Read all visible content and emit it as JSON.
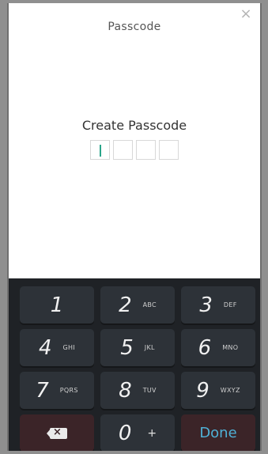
{
  "header": {
    "title": "Passcode"
  },
  "close_icon": "×",
  "prompt": "Create Passcode",
  "keypad": {
    "keys": [
      {
        "digit": "1",
        "letters": ""
      },
      {
        "digit": "2",
        "letters": "ABC"
      },
      {
        "digit": "3",
        "letters": "DEF"
      },
      {
        "digit": "4",
        "letters": "GHI"
      },
      {
        "digit": "5",
        "letters": "JKL"
      },
      {
        "digit": "6",
        "letters": "MNO"
      },
      {
        "digit": "7",
        "letters": "PQRS"
      },
      {
        "digit": "8",
        "letters": "TUV"
      },
      {
        "digit": "9",
        "letters": "WXYZ"
      }
    ],
    "zero": {
      "digit": "0",
      "extra": "+"
    },
    "done": "Done",
    "delete_icon": "×"
  },
  "colors": {
    "accent": "#2aa58a",
    "keypad_bg": "#1f2226",
    "key_bg": "#2d3238",
    "danger_key_bg": "#3b2428",
    "done_text": "#4fb0d6"
  }
}
